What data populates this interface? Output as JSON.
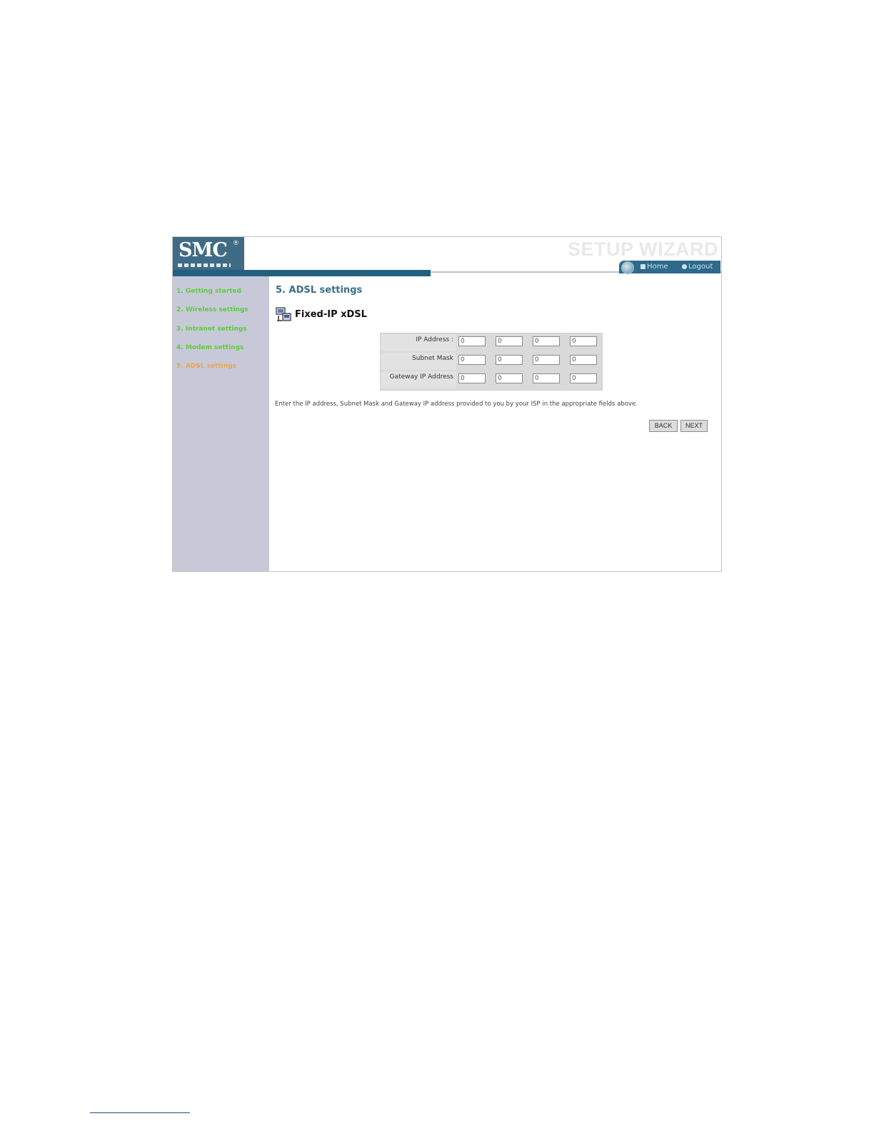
{
  "header": {
    "logo_text": "SMC",
    "logo_reg": "®",
    "wizard_title": "SETUP WIZARD",
    "nav": {
      "home_label": "Home",
      "logout_label": "Logout"
    }
  },
  "sidebar": {
    "steps": [
      {
        "label": "1. Getting started"
      },
      {
        "label": "2. Wireless settings"
      },
      {
        "label": "3. Intranet settings"
      },
      {
        "label": "4. Modem settings"
      },
      {
        "label": "5. ADSL settings"
      }
    ],
    "colors": {
      "done": "#5dcc3d",
      "current": "#e8a64a"
    }
  },
  "main": {
    "section_title": "5. ADSL settings",
    "connection_title": "Fixed-IP xDSL",
    "rows": [
      {
        "label": "IP Address :",
        "octets": [
          "0",
          "0",
          "0",
          "0"
        ]
      },
      {
        "label": "Subnet Mask",
        "octets": [
          "0",
          "0",
          "0",
          "0"
        ]
      },
      {
        "label": "Gateway IP Address",
        "octets": [
          "0",
          "0",
          "0",
          "0"
        ]
      }
    ],
    "help_text": "Enter the IP address, Subnet Mask and Gateway IP address provided to you by your ISP in the appropriate fields above.",
    "back_label": "BACK",
    "next_label": "NEXT"
  },
  "colors": {
    "accent": "#23607f",
    "sidebar_bg": "#c7c9d8"
  }
}
